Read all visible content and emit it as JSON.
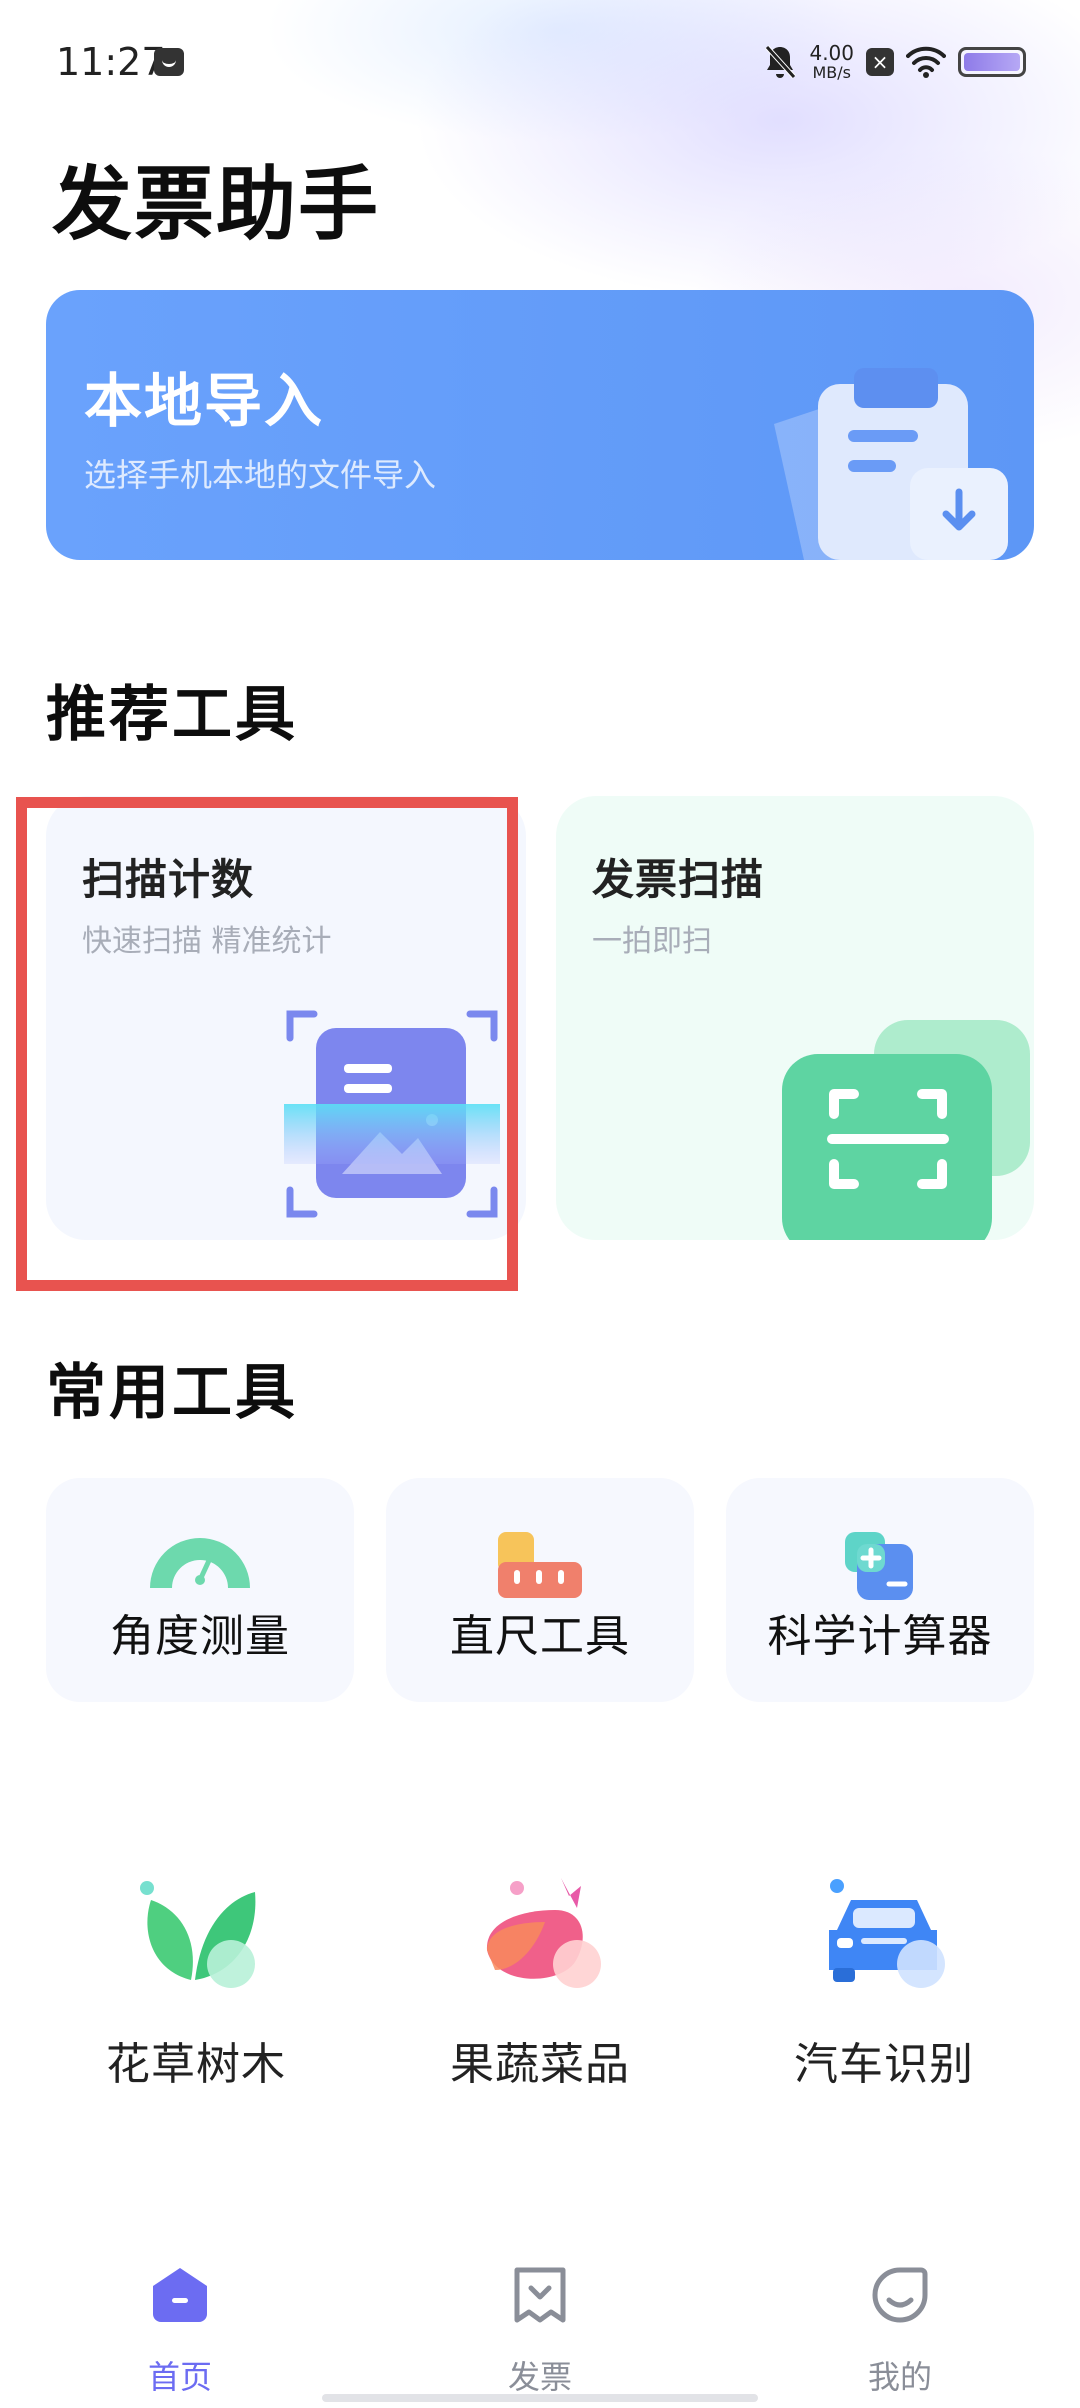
{
  "status_bar": {
    "time": "11:27",
    "net_speed_value": "4.00",
    "net_speed_unit": "MB/s",
    "battery_level": 1.0
  },
  "page_title": "发票助手",
  "import_banner": {
    "title": "本地导入",
    "subtitle": "选择手机本地的文件导入"
  },
  "recommended": {
    "section_title": "推荐工具",
    "cards": [
      {
        "title": "扫描计数",
        "subtitle": "快速扫描 精准统计",
        "icon": "scan-image-icon"
      },
      {
        "title": "发票扫描",
        "subtitle": "一拍即扫",
        "icon": "scan-frame-icon"
      }
    ]
  },
  "common": {
    "section_title": "常用工具",
    "tools": [
      {
        "label": "角度测量",
        "icon": "protractor-icon"
      },
      {
        "label": "直尺工具",
        "icon": "ruler-icon"
      },
      {
        "label": "科学计算器",
        "icon": "calculator-icon"
      }
    ]
  },
  "identify": [
    {
      "label": "花草树木",
      "icon": "leaf-icon"
    },
    {
      "label": "果蔬菜品",
      "icon": "eggplant-icon"
    },
    {
      "label": "汽车识别",
      "icon": "car-icon"
    }
  ],
  "bottom_nav": [
    {
      "label": "首页",
      "icon": "home-icon",
      "active": true
    },
    {
      "label": "发票",
      "icon": "receipt-icon",
      "active": false
    },
    {
      "label": "我的",
      "icon": "profile-face-icon",
      "active": false
    }
  ],
  "colors": {
    "accent": "#6c6cf2",
    "banner_blue": "#5d97f6",
    "highlight_red": "#e8534f",
    "green": "#5fd4a4"
  }
}
